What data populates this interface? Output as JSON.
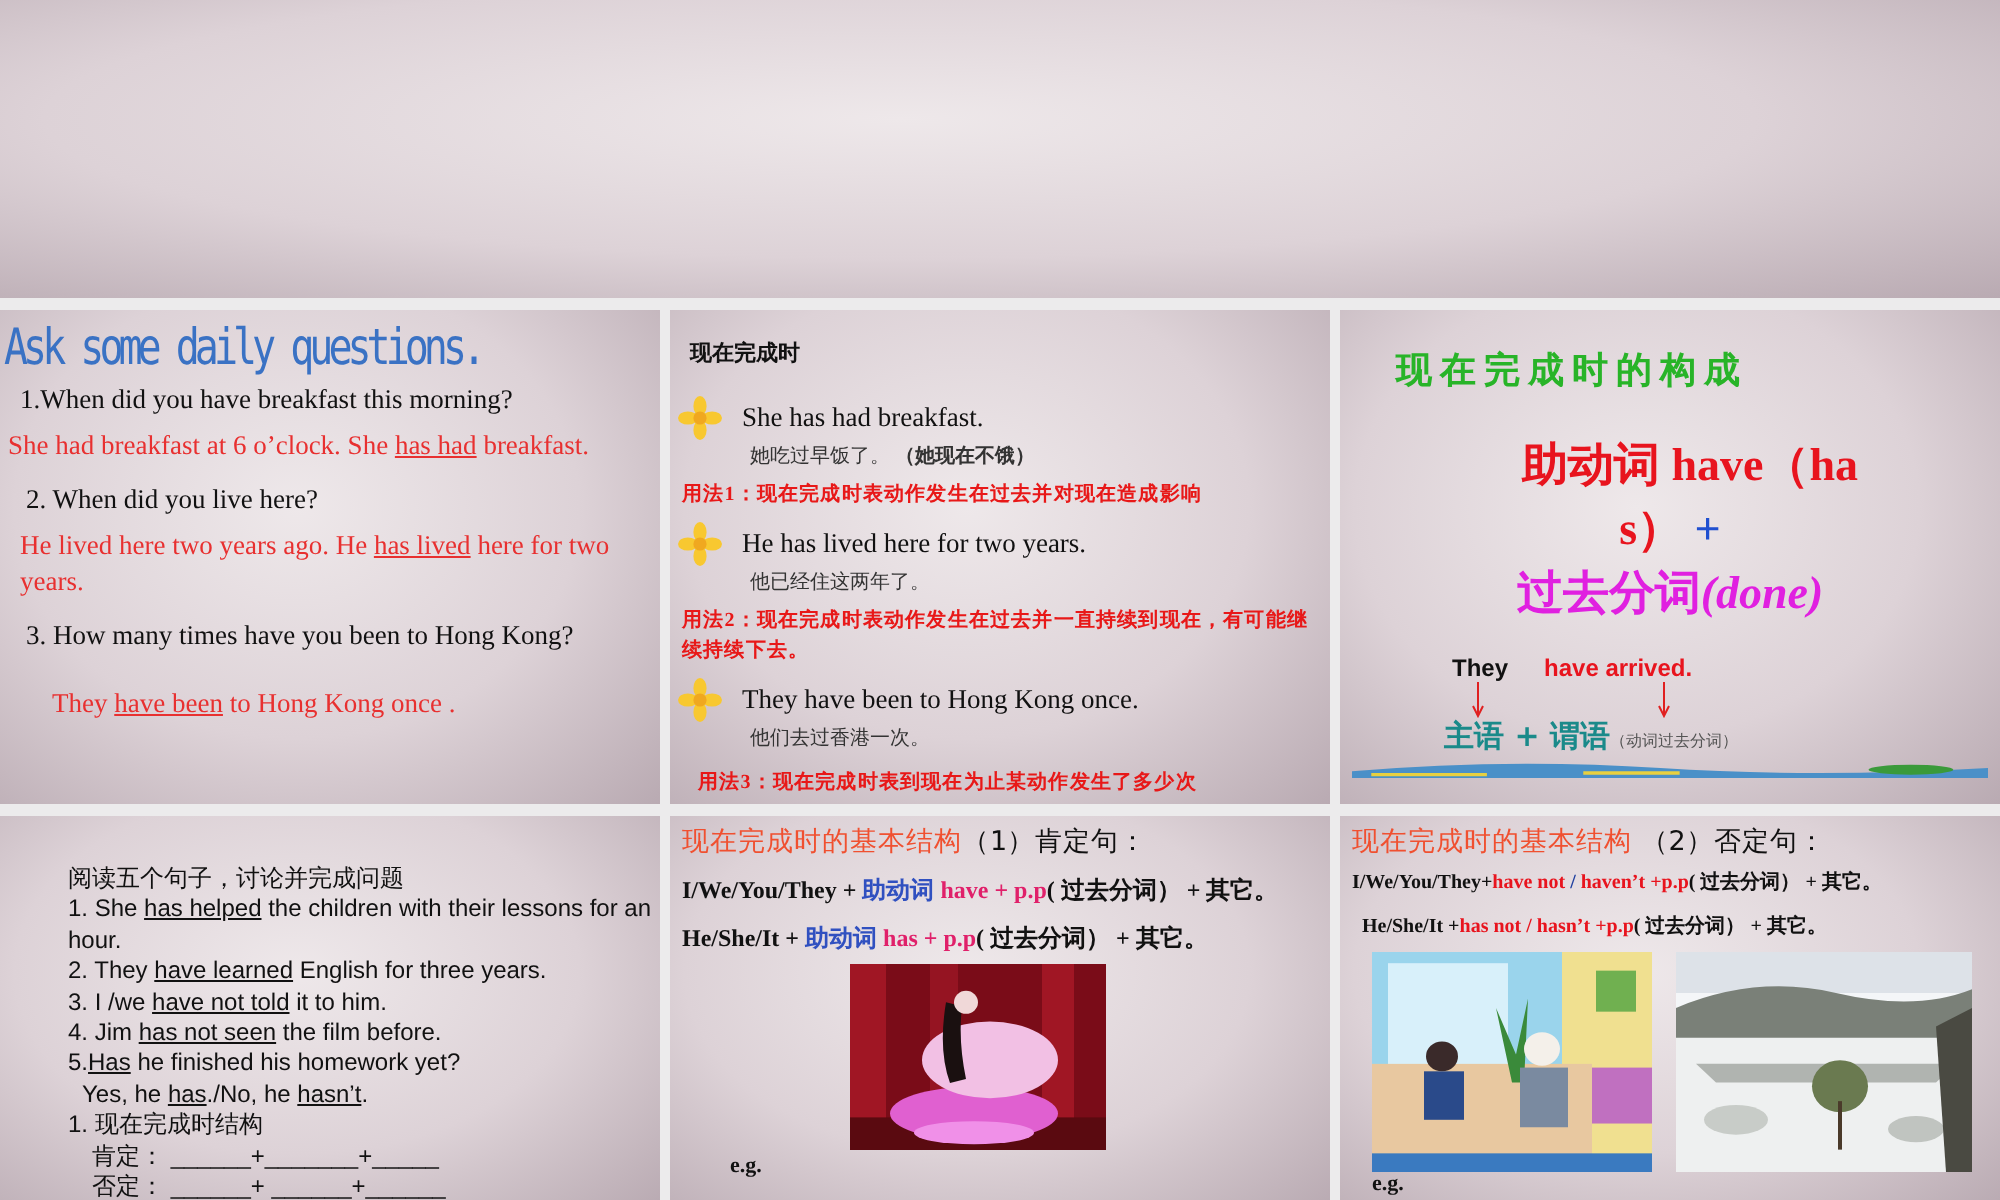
{
  "slides": [
    {
      "lines": [
        {
          "kind": "title",
          "segments": [
            {
              "text": "Ask some daily questions."
            }
          ]
        },
        {
          "kind": "question",
          "segments": [
            {
              "text": "1.When did you have breakfast this morning?"
            }
          ]
        },
        {
          "kind": "answer",
          "segments": [
            {
              "text": "She had breakfast at 6 o’clock. She "
            },
            {
              "text": "has had",
              "underline": true
            },
            {
              "text": " breakfast."
            }
          ]
        },
        {
          "kind": "question",
          "segments": [
            {
              "text": "2. When did you live here?"
            }
          ]
        },
        {
          "kind": "answer",
          "segments": [
            {
              "text": "He lived here two years ago. He "
            },
            {
              "text": "has lived",
              "underline": true
            },
            {
              "text": " here for two years."
            }
          ]
        },
        {
          "kind": "question",
          "segments": [
            {
              "text": "3. How many times have you been to Hong Kong?"
            }
          ]
        },
        {
          "kind": "answer-indent",
          "segments": [
            {
              "text": "They "
            },
            {
              "text": "have been",
              "underline": true
            },
            {
              "text": " to Hong Kong once ."
            }
          ]
        }
      ]
    },
    {
      "lines": [
        {
          "kind": "heading",
          "segments": [
            {
              "text": "现在完成时"
            }
          ]
        },
        {
          "kind": "bullet",
          "segments": [
            {
              "text": "She has had breakfast."
            }
          ]
        },
        {
          "kind": "translation",
          "segments": [
            {
              "text": "她吃过早饭了。 "
            },
            {
              "text": "（她现在不饿）",
              "bold": true
            }
          ]
        },
        {
          "kind": "usage",
          "segments": [
            {
              "text": "用法1：现在完成时表动作发生在过去并对现在造成影响"
            }
          ]
        },
        {
          "kind": "bullet",
          "segments": [
            {
              "text": "He has lived here for two years."
            }
          ]
        },
        {
          "kind": "translation",
          "segments": [
            {
              "text": "他已经住这两年了。"
            }
          ]
        },
        {
          "kind": "usage",
          "segments": [
            {
              "text": "用法2：现在完成时表动作发生在过去并一直持续到现在，有可能继续持续下去。"
            }
          ]
        },
        {
          "kind": "bullet",
          "segments": [
            {
              "text": "They have been to Hong Kong once."
            }
          ]
        },
        {
          "kind": "translation",
          "segments": [
            {
              "text": "他们去过香港一次。"
            }
          ]
        },
        {
          "kind": "usage",
          "segments": [
            {
              "text": "用法3：现在完成时表到现在为止某动作发生了多少次"
            }
          ]
        }
      ]
    },
    {
      "lines": [
        {
          "kind": "green-title",
          "segments": [
            {
              "text": "现在完成时的构成"
            }
          ]
        },
        {
          "kind": "big",
          "segments": [
            {
              "text": "助动词 have（ha",
              "color": "#e8141e"
            }
          ]
        },
        {
          "kind": "big",
          "segments": [
            {
              "text": "s）",
              "color": "#e8141e"
            },
            {
              "text": " +",
              "color": "#2050d0"
            }
          ]
        },
        {
          "kind": "big",
          "segments": [
            {
              "text": "过去分词",
              "color": "#e020e0"
            },
            {
              "text": "(done)",
              "color": "#e020e0",
              "italic": true
            }
          ]
        },
        {
          "kind": "example",
          "segments": [
            {
              "text": "They",
              "color": "#111111"
            },
            {
              "text": "have  arrived.",
              "color": "#e8141e"
            }
          ]
        },
        {
          "kind": "arrows"
        },
        {
          "kind": "labels",
          "segments": [
            {
              "text": "主语 + 谓语",
              "color": "#1a8a8a"
            },
            {
              "text": "（动词过去分词）",
              "color": "#555555",
              "small": true
            }
          ]
        },
        {
          "kind": "strip"
        }
      ]
    },
    {
      "lines": [
        {
          "kind": "sans",
          "segments": [
            {
              "text": "阅读五个句子，讨论并完成问题"
            }
          ]
        },
        {
          "kind": "sans",
          "segments": [
            {
              "text": "1. She "
            },
            {
              "text": "has helped",
              "underline": true
            },
            {
              "text": " the children with their lessons for an hour."
            }
          ]
        },
        {
          "kind": "sans",
          "segments": [
            {
              "text": "2. They "
            },
            {
              "text": "have learned",
              "underline": true
            },
            {
              "text": " English for three years."
            }
          ]
        },
        {
          "kind": "sans",
          "segments": [
            {
              "text": "3. I /we "
            },
            {
              "text": "have not told",
              "underline": true
            },
            {
              "text": " it to him."
            }
          ]
        },
        {
          "kind": "sans",
          "segments": [
            {
              "text": "4. Jim "
            },
            {
              "text": "has not seen",
              "underline": true
            },
            {
              "text": " the film before."
            }
          ]
        },
        {
          "kind": "sans",
          "segments": [
            {
              "text": "5."
            },
            {
              "text": "Has",
              "underline": true
            },
            {
              "text": " he finished his homework yet?"
            }
          ]
        },
        {
          "kind": "sans-indent",
          "segments": [
            {
              "text": "Yes, he "
            },
            {
              "text": "has",
              "underline": true
            },
            {
              "text": "./No, he "
            },
            {
              "text": "hasn’t",
              "underline": true
            },
            {
              "text": "."
            }
          ]
        },
        {
          "kind": "sans",
          "segments": [
            {
              "text": "1. 现在完成时结构"
            }
          ]
        },
        {
          "kind": "sans-blank",
          "segments": [
            {
              "text": "肯定：  ______+_______+_____"
            }
          ]
        },
        {
          "kind": "sans-blank",
          "segments": [
            {
              "text": "否定：  ______+ ______+______"
            }
          ]
        }
      ]
    },
    {
      "lines": [
        {
          "kind": "struct-title",
          "segments": [
            {
              "text": "现在完成时的基本结构"
            },
            {
              "text": "（1）肯定句：",
              "color": "#111111"
            }
          ]
        },
        {
          "kind": "formula",
          "segments": [
            {
              "text": "I/We/You/They +  "
            },
            {
              "text": "助动词 ",
              "color": "#3050c0"
            },
            {
              "text": "have + p.p",
              "color": "#e0206a"
            },
            {
              "text": "( 过去分词） + 其它。"
            }
          ]
        },
        {
          "kind": "formula",
          "segments": [
            {
              "text": "He/She/It +  "
            },
            {
              "text": "助动词 ",
              "color": "#3050c0"
            },
            {
              "text": "has + p.p",
              "color": "#e0206a"
            },
            {
              "text": "( 过去分词） + 其它。"
            }
          ]
        },
        {
          "kind": "picture"
        },
        {
          "kind": "eg",
          "segments": [
            {
              "text": "e.g."
            }
          ]
        }
      ]
    },
    {
      "lines": [
        {
          "kind": "struct-title",
          "segments": [
            {
              "text": "现在完成时的基本结构 "
            },
            {
              "text": "（2）否定句：",
              "color": "#111111"
            }
          ]
        },
        {
          "kind": "formula-small",
          "segments": [
            {
              "text": "I/We/You/They+"
            },
            {
              "text": "have  not ",
              "color": "#e8141e"
            },
            {
              "text": "/ ",
              "color": "#2040a0"
            },
            {
              "text": "haven’t +p.p",
              "color": "#e8141e"
            },
            {
              "text": "( 过去分词） + 其它。"
            }
          ]
        },
        {
          "kind": "formula-small-indent",
          "segments": [
            {
              "text": "He/She/It +"
            },
            {
              "text": "has not / hasn’t +p.p",
              "color": "#e8141e"
            },
            {
              "text": "( 过去分词） + 其它。"
            }
          ]
        },
        {
          "kind": "pictures"
        },
        {
          "kind": "eg",
          "segments": [
            {
              "text": "e.g."
            }
          ]
        }
      ]
    }
  ]
}
